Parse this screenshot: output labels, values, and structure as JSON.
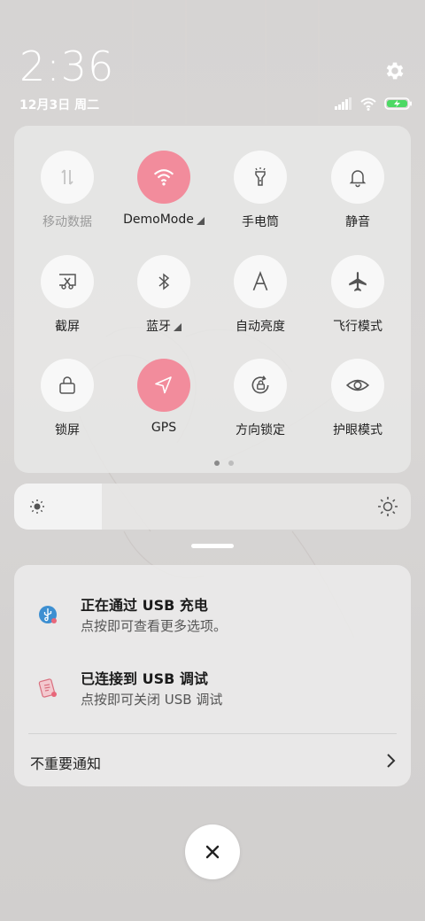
{
  "status": {
    "time": "2:36",
    "date": "12月3日 周二",
    "settings_icon": "gear-icon",
    "signal_icon": "signal-icon",
    "wifi_icon": "wifi-icon",
    "battery_icon": "battery-charging-icon"
  },
  "tiles": [
    {
      "label": "移动数据",
      "icon": "mobile-data-icon",
      "state": "disabled",
      "dropdown": false
    },
    {
      "label": "DemoMode",
      "icon": "wifi-icon",
      "state": "on",
      "dropdown": true
    },
    {
      "label": "手电筒",
      "icon": "flashlight-icon",
      "state": "off",
      "dropdown": false
    },
    {
      "label": "静音",
      "icon": "bell-icon",
      "state": "off",
      "dropdown": false
    },
    {
      "label": "截屏",
      "icon": "screenshot-icon",
      "state": "off",
      "dropdown": false
    },
    {
      "label": "蓝牙",
      "icon": "bluetooth-icon",
      "state": "off",
      "dropdown": true
    },
    {
      "label": "自动亮度",
      "icon": "auto-brightness-icon",
      "state": "off",
      "dropdown": false
    },
    {
      "label": "飞行模式",
      "icon": "airplane-icon",
      "state": "off",
      "dropdown": false
    },
    {
      "label": "锁屏",
      "icon": "lock-icon",
      "state": "off",
      "dropdown": false
    },
    {
      "label": "GPS",
      "icon": "location-icon",
      "state": "on",
      "dropdown": false
    },
    {
      "label": "方向锁定",
      "icon": "rotation-lock-icon",
      "state": "off",
      "dropdown": false
    },
    {
      "label": "护眼模式",
      "icon": "eye-icon",
      "state": "off",
      "dropdown": false
    }
  ],
  "pager": {
    "pages": 2,
    "current": 1
  },
  "brightness": {
    "level": 0.22
  },
  "notifications": [
    {
      "title": "正在通过 USB 充电",
      "subtitle": "点按即可查看更多选项。",
      "icon": "usb-icon"
    },
    {
      "title": "已连接到 USB 调试",
      "subtitle": "点按即可关闭 USB 调试",
      "icon": "usb-debug-icon"
    }
  ],
  "unimportant": {
    "label": "不重要通知"
  },
  "colors": {
    "accent": "#f28c9c",
    "white": "#ffffff"
  }
}
